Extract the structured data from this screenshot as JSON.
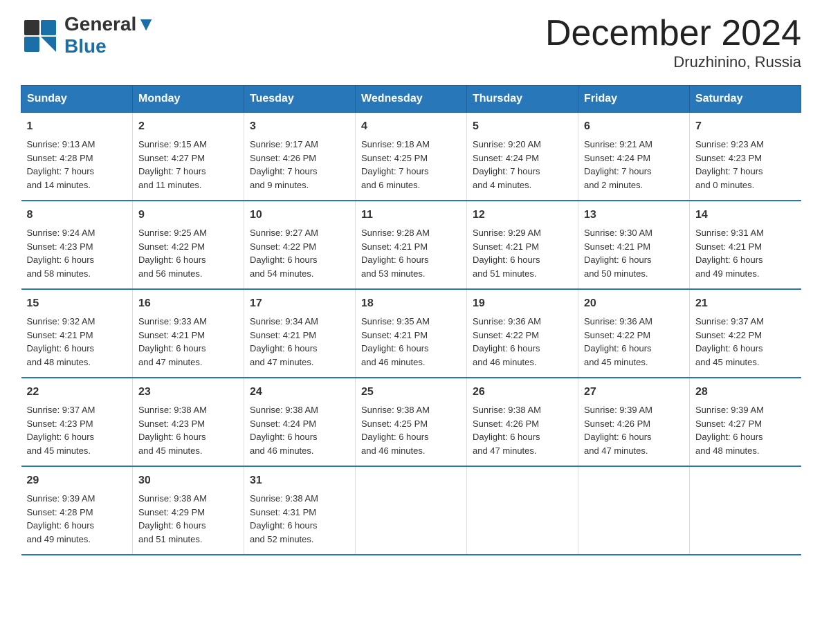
{
  "logo": {
    "line1": "General",
    "line2": "Blue"
  },
  "title": "December 2024",
  "subtitle": "Druzhinino, Russia",
  "days_of_week": [
    "Sunday",
    "Monday",
    "Tuesday",
    "Wednesday",
    "Thursday",
    "Friday",
    "Saturday"
  ],
  "weeks": [
    [
      {
        "day": "1",
        "info": "Sunrise: 9:13 AM\nSunset: 4:28 PM\nDaylight: 7 hours\nand 14 minutes."
      },
      {
        "day": "2",
        "info": "Sunrise: 9:15 AM\nSunset: 4:27 PM\nDaylight: 7 hours\nand 11 minutes."
      },
      {
        "day": "3",
        "info": "Sunrise: 9:17 AM\nSunset: 4:26 PM\nDaylight: 7 hours\nand 9 minutes."
      },
      {
        "day": "4",
        "info": "Sunrise: 9:18 AM\nSunset: 4:25 PM\nDaylight: 7 hours\nand 6 minutes."
      },
      {
        "day": "5",
        "info": "Sunrise: 9:20 AM\nSunset: 4:24 PM\nDaylight: 7 hours\nand 4 minutes."
      },
      {
        "day": "6",
        "info": "Sunrise: 9:21 AM\nSunset: 4:24 PM\nDaylight: 7 hours\nand 2 minutes."
      },
      {
        "day": "7",
        "info": "Sunrise: 9:23 AM\nSunset: 4:23 PM\nDaylight: 7 hours\nand 0 minutes."
      }
    ],
    [
      {
        "day": "8",
        "info": "Sunrise: 9:24 AM\nSunset: 4:23 PM\nDaylight: 6 hours\nand 58 minutes."
      },
      {
        "day": "9",
        "info": "Sunrise: 9:25 AM\nSunset: 4:22 PM\nDaylight: 6 hours\nand 56 minutes."
      },
      {
        "day": "10",
        "info": "Sunrise: 9:27 AM\nSunset: 4:22 PM\nDaylight: 6 hours\nand 54 minutes."
      },
      {
        "day": "11",
        "info": "Sunrise: 9:28 AM\nSunset: 4:21 PM\nDaylight: 6 hours\nand 53 minutes."
      },
      {
        "day": "12",
        "info": "Sunrise: 9:29 AM\nSunset: 4:21 PM\nDaylight: 6 hours\nand 51 minutes."
      },
      {
        "day": "13",
        "info": "Sunrise: 9:30 AM\nSunset: 4:21 PM\nDaylight: 6 hours\nand 50 minutes."
      },
      {
        "day": "14",
        "info": "Sunrise: 9:31 AM\nSunset: 4:21 PM\nDaylight: 6 hours\nand 49 minutes."
      }
    ],
    [
      {
        "day": "15",
        "info": "Sunrise: 9:32 AM\nSunset: 4:21 PM\nDaylight: 6 hours\nand 48 minutes."
      },
      {
        "day": "16",
        "info": "Sunrise: 9:33 AM\nSunset: 4:21 PM\nDaylight: 6 hours\nand 47 minutes."
      },
      {
        "day": "17",
        "info": "Sunrise: 9:34 AM\nSunset: 4:21 PM\nDaylight: 6 hours\nand 47 minutes."
      },
      {
        "day": "18",
        "info": "Sunrise: 9:35 AM\nSunset: 4:21 PM\nDaylight: 6 hours\nand 46 minutes."
      },
      {
        "day": "19",
        "info": "Sunrise: 9:36 AM\nSunset: 4:22 PM\nDaylight: 6 hours\nand 46 minutes."
      },
      {
        "day": "20",
        "info": "Sunrise: 9:36 AM\nSunset: 4:22 PM\nDaylight: 6 hours\nand 45 minutes."
      },
      {
        "day": "21",
        "info": "Sunrise: 9:37 AM\nSunset: 4:22 PM\nDaylight: 6 hours\nand 45 minutes."
      }
    ],
    [
      {
        "day": "22",
        "info": "Sunrise: 9:37 AM\nSunset: 4:23 PM\nDaylight: 6 hours\nand 45 minutes."
      },
      {
        "day": "23",
        "info": "Sunrise: 9:38 AM\nSunset: 4:23 PM\nDaylight: 6 hours\nand 45 minutes."
      },
      {
        "day": "24",
        "info": "Sunrise: 9:38 AM\nSunset: 4:24 PM\nDaylight: 6 hours\nand 46 minutes."
      },
      {
        "day": "25",
        "info": "Sunrise: 9:38 AM\nSunset: 4:25 PM\nDaylight: 6 hours\nand 46 minutes."
      },
      {
        "day": "26",
        "info": "Sunrise: 9:38 AM\nSunset: 4:26 PM\nDaylight: 6 hours\nand 47 minutes."
      },
      {
        "day": "27",
        "info": "Sunrise: 9:39 AM\nSunset: 4:26 PM\nDaylight: 6 hours\nand 47 minutes."
      },
      {
        "day": "28",
        "info": "Sunrise: 9:39 AM\nSunset: 4:27 PM\nDaylight: 6 hours\nand 48 minutes."
      }
    ],
    [
      {
        "day": "29",
        "info": "Sunrise: 9:39 AM\nSunset: 4:28 PM\nDaylight: 6 hours\nand 49 minutes."
      },
      {
        "day": "30",
        "info": "Sunrise: 9:38 AM\nSunset: 4:29 PM\nDaylight: 6 hours\nand 51 minutes."
      },
      {
        "day": "31",
        "info": "Sunrise: 9:38 AM\nSunset: 4:31 PM\nDaylight: 6 hours\nand 52 minutes."
      },
      {
        "day": "",
        "info": ""
      },
      {
        "day": "",
        "info": ""
      },
      {
        "day": "",
        "info": ""
      },
      {
        "day": "",
        "info": ""
      }
    ]
  ]
}
